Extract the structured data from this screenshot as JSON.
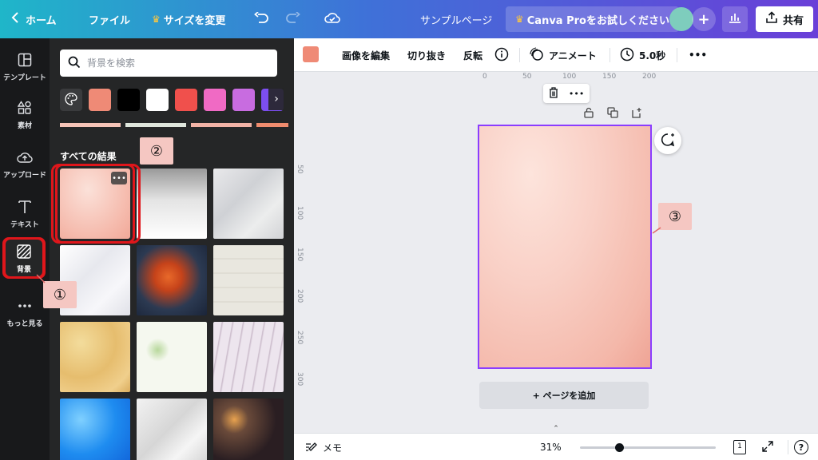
{
  "topbar": {
    "home_label": "ホーム",
    "file_label": "ファイル",
    "resize_label": "サイズを変更",
    "doc_name": "サンプルページ",
    "pro_label": "Canva Proをお試しください",
    "share_label": "共有",
    "add_symbol": "+"
  },
  "rail": {
    "items": [
      {
        "label": "テンプレート"
      },
      {
        "label": "素材"
      },
      {
        "label": "アップロード"
      },
      {
        "label": "テキスト"
      },
      {
        "label": "背景"
      },
      {
        "label": "もっと見る"
      }
    ]
  },
  "panel": {
    "search_placeholder": "背景を検索",
    "swatches": [
      "#ef8a76",
      "#000000",
      "#ffffff",
      "#f0504c",
      "#f06ac4",
      "#c86ce0",
      "#7c4ef0"
    ],
    "section_title": "すべての結果",
    "more_symbol": "•••"
  },
  "ctxbar": {
    "edit_image": "画像を編集",
    "crop": "切り抜き",
    "flip": "反転",
    "animate": "アニメート",
    "duration": "5.0秒",
    "more": "•••"
  },
  "canvas": {
    "ruler_h": [
      "0",
      "50",
      "100",
      "150",
      "200"
    ],
    "ruler_v": [
      "50",
      "100",
      "150",
      "200",
      "250",
      "300"
    ],
    "add_page": "+ ページを追加",
    "float_more": "•••"
  },
  "bottombar": {
    "notes": "メモ",
    "zoom": "31%",
    "zoom_fraction": 0.29,
    "page_num": "1",
    "help": "?"
  },
  "callouts": {
    "one": "①",
    "two": "②",
    "three": "③"
  },
  "colors": {
    "accent": "#8b3dff",
    "highlight": "#e0161b",
    "page_bg": "#f6c2b6"
  }
}
